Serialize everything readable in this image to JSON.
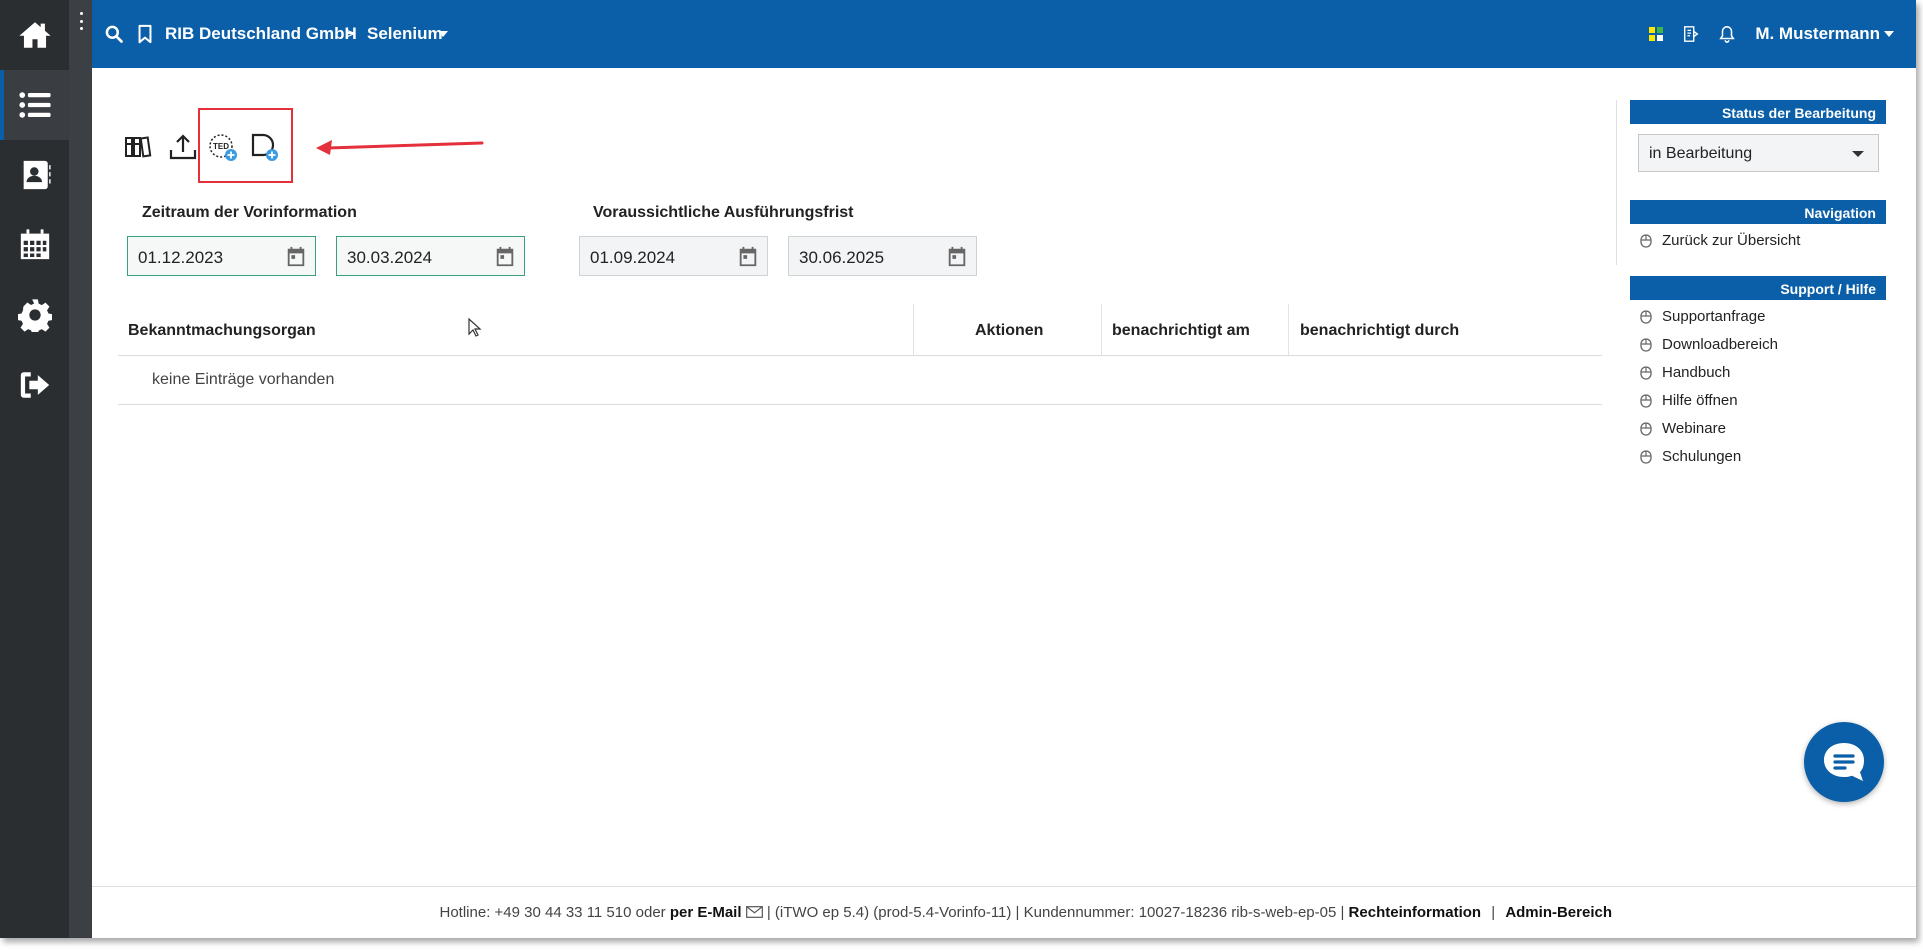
{
  "topbar": {
    "company": "RIB Deutschland GmbH",
    "separator": ">",
    "project": "Selenium",
    "user": "M. Mustermann"
  },
  "filters": {
    "vorinfo_label": "Zeitraum der Vorinformation",
    "vorinfo_from": "01.12.2023",
    "vorinfo_to": "30.03.2024",
    "frist_label": "Voraussichtliche Ausführungsfrist",
    "frist_from": "01.09.2024",
    "frist_to": "30.06.2025"
  },
  "table": {
    "columns": [
      "Bekanntmachungsorgan",
      "Aktionen",
      "benachrichtigt am",
      "benachrichtigt durch"
    ],
    "empty_text": "keine Einträge vorhanden"
  },
  "panel": {
    "status_title": "Status der Bearbeitung",
    "status_value": "in Bearbeitung",
    "nav_title": "Navigation",
    "nav_items": [
      "Zurück zur Übersicht"
    ],
    "support_title": "Support / Hilfe",
    "support_items": [
      "Supportanfrage",
      "Downloadbereich",
      "Handbuch",
      "Hilfe öffnen",
      "Webinare",
      "Schulungen"
    ]
  },
  "footer": {
    "hotline": "Hotline: +49 30 44 33 11 510 oder",
    "email": "per E-Mail",
    "version": "|  (iTWO ep 5.4) (prod-5.4-Vorinfo-11)  |  Kundennummer: 10027-18236 rib-s-web-ep-05 |",
    "rechte": "Rechteinformation",
    "sep": "|",
    "admin": "Admin-Bereich"
  },
  "colors": {
    "brand": "#0a5fa8",
    "sidebar": "#2b2e31",
    "highlight": "#e4303a",
    "focus": "#3aa17e"
  },
  "icons": {
    "sidebar": [
      "home-icon",
      "list-icon",
      "contacts-icon",
      "calendar-icon",
      "gear-icon",
      "logout-icon"
    ],
    "toolbar": [
      "binders-icon",
      "upload-icon",
      "ted-add-icon",
      "document-add-icon"
    ]
  }
}
